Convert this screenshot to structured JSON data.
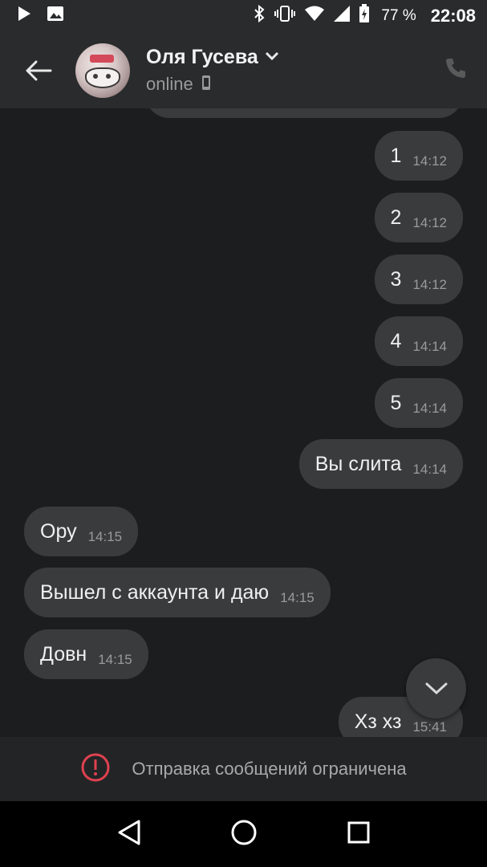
{
  "status_bar": {
    "battery": "77 %",
    "time": "22:08",
    "icons": [
      "play-icon",
      "image-icon",
      "bluetooth-icon",
      "vibrate-icon",
      "wifi-icon",
      "signal-icon",
      "battery-icon"
    ]
  },
  "header": {
    "name": "Оля Гусева",
    "status": "online",
    "icons": [
      "back-arrow-icon",
      "chevron-down-icon",
      "mobile-device-icon",
      "phone-icon"
    ]
  },
  "messages": [
    {
      "direction": "out",
      "text": "1",
      "time": "14:12"
    },
    {
      "direction": "out",
      "text": "2",
      "time": "14:12"
    },
    {
      "direction": "out",
      "text": "3",
      "time": "14:12"
    },
    {
      "direction": "out",
      "text": "4",
      "time": "14:14"
    },
    {
      "direction": "out",
      "text": "5",
      "time": "14:14"
    },
    {
      "direction": "out",
      "text": "Вы слита",
      "time": "14:14"
    },
    {
      "direction": "in",
      "text": "Ору",
      "time": "14:15"
    },
    {
      "direction": "in",
      "text": "Вышел с аккаунта и даю",
      "time": "14:15"
    },
    {
      "direction": "in",
      "text": "Довн",
      "time": "14:15"
    },
    {
      "direction": "out",
      "text": "Хз хз",
      "time": "15:41"
    }
  ],
  "restriction": {
    "text": "Отправка сообщений ограничена",
    "icon": "alert-circle-icon",
    "color": "#e0414f"
  },
  "nav": {
    "icons": [
      "back-triangle-icon",
      "home-circle-icon",
      "recents-square-icon"
    ]
  }
}
